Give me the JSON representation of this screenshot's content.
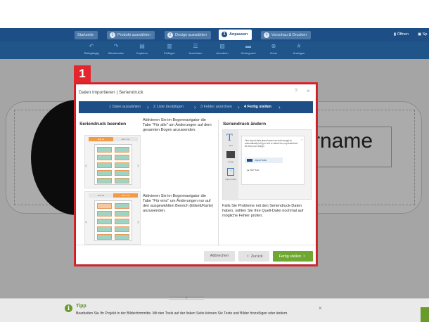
{
  "nav": {
    "steps": [
      {
        "num": "",
        "label": "Startseite"
      },
      {
        "num": "1",
        "label": "Produkt auswählen"
      },
      {
        "num": "2",
        "label": "Design auswählen"
      },
      {
        "num": "3",
        "label": "Anpassen"
      },
      {
        "num": "4",
        "label": "Vorschau & Drucken"
      }
    ],
    "open_label": "Öffnen",
    "save_label": "Sp"
  },
  "toolbar": {
    "items": [
      "Rückgängig",
      "Wiederholen",
      "Kopieren",
      "Einfügen",
      "Ausrichten",
      "Anordnen",
      "Hintergrund",
      "Zoom",
      "Anzeigen"
    ]
  },
  "canvas": {
    "name_text": "rname"
  },
  "badge": "1",
  "dialog": {
    "title": "Daten importieren | Seriendruck",
    "help": "?",
    "close": "×",
    "wizard": [
      "1 Datei auswählen",
      "2 Liste bestätigen",
      "3 Felder anordnen",
      "4 Fertig stellen"
    ],
    "left_heading": "Seriendruck beenden",
    "right_heading": "Seriendruck ändern",
    "thumb_tabs": [
      "Edit All",
      "Edit One"
    ],
    "text_all": "Aktivieren Sie im Bogennavigator die Tabe \"Für alle\" um Änderungen auf dem gesamten Bogen anzuwenden.",
    "text_one": "Aktivieren Sie im Bogennavigator die Tabe \"Für eins\" um Änderungen nur auf den ausgewählten Bereich (Etikett/Karte) anzuwenden.",
    "right_text": "Falls Sie Probleme mit den Seriendruck-Daten haben, sollten Sie Ihre Quell-Datei nochmal auf mögliche Fehler prüfen.",
    "shot": {
      "side_labels": [
        "Text",
        "Image",
        "Import Data"
      ],
      "panel_text": "One import data place known as mail merge) to automatically bring in text or data from a spreadsheet file into your design.",
      "button": "Import Data",
      "demo": "See How"
    },
    "buttons": {
      "cancel": "Abbrechen",
      "back": "Zurück",
      "finish": "Fertig stellen"
    }
  },
  "tip": {
    "title": "Tipp",
    "text": "Bearbeiten Sie Ihr Projekt in der Bildschirmmitte. Mit den Tools auf der linken Seite können Sie Texte und Bilder hinzufügen oder ändern."
  },
  "colors": {
    "accent": "#1d4f86",
    "highlight": "#e3252d",
    "finish": "#6fa830"
  }
}
